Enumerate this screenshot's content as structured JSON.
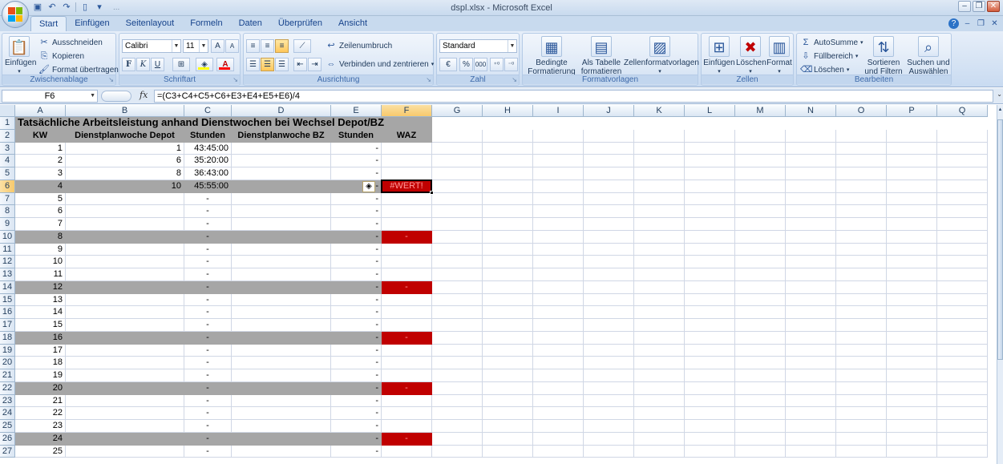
{
  "window": {
    "title": "dspl.xlsx - Microsoft Excel",
    "qat_hint": "..."
  },
  "tabs": [
    "Start",
    "Einfügen",
    "Seitenlayout",
    "Formeln",
    "Daten",
    "Überprüfen",
    "Ansicht"
  ],
  "ribbon": {
    "clipboard": {
      "label": "Zwischenablage",
      "paste": "Einfügen",
      "cut": "Ausschneiden",
      "copy": "Kopieren",
      "format_painter": "Format übertragen"
    },
    "font": {
      "label": "Schriftart",
      "name": "Calibri",
      "size": "11",
      "bold": "F",
      "italic": "K",
      "underline": "U"
    },
    "alignment": {
      "label": "Ausrichtung",
      "wrap": "Zeilenumbruch",
      "merge": "Verbinden und zentrieren"
    },
    "number": {
      "label": "Zahl",
      "format": "Standard",
      "percent": "%",
      "thousands": "000"
    },
    "styles": {
      "label": "Formatvorlagen",
      "conditional_1": "Bedingte",
      "conditional_2": "Formatierung",
      "table_1": "Als Tabelle",
      "table_2": "formatieren",
      "cellstyles": "Zellenformatvorlagen"
    },
    "cells": {
      "label": "Zellen",
      "insert": "Einfügen",
      "delete": "Löschen",
      "format": "Format"
    },
    "editing": {
      "label": "Bearbeiten",
      "autosum": "AutoSumme",
      "fill": "Füllbereich",
      "clear": "Löschen",
      "sort_1": "Sortieren",
      "sort_2": "und Filtern",
      "find_1": "Suchen und",
      "find_2": "Auswählen"
    }
  },
  "formula_bar": {
    "name_box": "F6",
    "fx": "fx",
    "formula": "=(C3+C4+C5+C6+E3+E4+E5+E6)/4"
  },
  "columns": [
    "A",
    "B",
    "C",
    "D",
    "E",
    "F",
    "G",
    "H",
    "I",
    "J",
    "K",
    "L",
    "M",
    "N",
    "O",
    "P",
    "Q"
  ],
  "sheet": {
    "title": "Tatsächliche Arbeitsleistung anhand Dienstwochen bei Wechsel Depot/BZ",
    "headers": {
      "a": "KW",
      "b": "Dienstplanwoche Depot",
      "c": "Stunden",
      "d": "Dienstplanwoche BZ",
      "e": "Stunden",
      "f": "WAZ"
    },
    "rows": [
      {
        "n": "3",
        "a": "1",
        "b": "1",
        "c": "43:45:00",
        "e": "-",
        "f": ""
      },
      {
        "n": "4",
        "a": "2",
        "b": "6",
        "c": "35:20:00",
        "e": "-",
        "f": ""
      },
      {
        "n": "5",
        "a": "3",
        "b": "8",
        "c": "36:43:00",
        "e": "-",
        "f": ""
      },
      {
        "n": "6",
        "a": "4",
        "b": "10",
        "c": "45:55:00",
        "e": "-",
        "f": "#WERT!"
      },
      {
        "n": "7",
        "a": "5",
        "b": "",
        "c": "-",
        "e": "-",
        "f": ""
      },
      {
        "n": "8",
        "a": "6",
        "b": "",
        "c": "-",
        "e": "-",
        "f": ""
      },
      {
        "n": "9",
        "a": "7",
        "b": "",
        "c": "-",
        "e": "-",
        "f": ""
      },
      {
        "n": "10",
        "a": "8",
        "b": "",
        "c": "-",
        "e": "-",
        "f": "-"
      },
      {
        "n": "11",
        "a": "9",
        "b": "",
        "c": "-",
        "e": "-",
        "f": ""
      },
      {
        "n": "12",
        "a": "10",
        "b": "",
        "c": "-",
        "e": "-",
        "f": ""
      },
      {
        "n": "13",
        "a": "11",
        "b": "",
        "c": "-",
        "e": "-",
        "f": ""
      },
      {
        "n": "14",
        "a": "12",
        "b": "",
        "c": "-",
        "e": "-",
        "f": "-"
      },
      {
        "n": "15",
        "a": "13",
        "b": "",
        "c": "-",
        "e": "-",
        "f": ""
      },
      {
        "n": "16",
        "a": "14",
        "b": "",
        "c": "-",
        "e": "-",
        "f": ""
      },
      {
        "n": "17",
        "a": "15",
        "b": "",
        "c": "-",
        "e": "-",
        "f": ""
      },
      {
        "n": "18",
        "a": "16",
        "b": "",
        "c": "-",
        "e": "-",
        "f": "-"
      },
      {
        "n": "19",
        "a": "17",
        "b": "",
        "c": "-",
        "e": "-",
        "f": ""
      },
      {
        "n": "20",
        "a": "18",
        "b": "",
        "c": "-",
        "e": "-",
        "f": ""
      },
      {
        "n": "21",
        "a": "19",
        "b": "",
        "c": "-",
        "e": "-",
        "f": ""
      },
      {
        "n": "22",
        "a": "20",
        "b": "",
        "c": "-",
        "e": "-",
        "f": "-"
      },
      {
        "n": "23",
        "a": "21",
        "b": "",
        "c": "-",
        "e": "-",
        "f": ""
      },
      {
        "n": "24",
        "a": "22",
        "b": "",
        "c": "-",
        "e": "-",
        "f": ""
      },
      {
        "n": "25",
        "a": "23",
        "b": "",
        "c": "-",
        "e": "-",
        "f": ""
      },
      {
        "n": "26",
        "a": "24",
        "b": "",
        "c": "-",
        "e": "-",
        "f": "-"
      },
      {
        "n": "27",
        "a": "25",
        "b": "",
        "c": "-",
        "e": "-",
        "f": ""
      }
    ]
  },
  "colors": {
    "gray_row": "#a6a6a6",
    "red_cell": "#c00000",
    "selection": "#f7c96c"
  }
}
